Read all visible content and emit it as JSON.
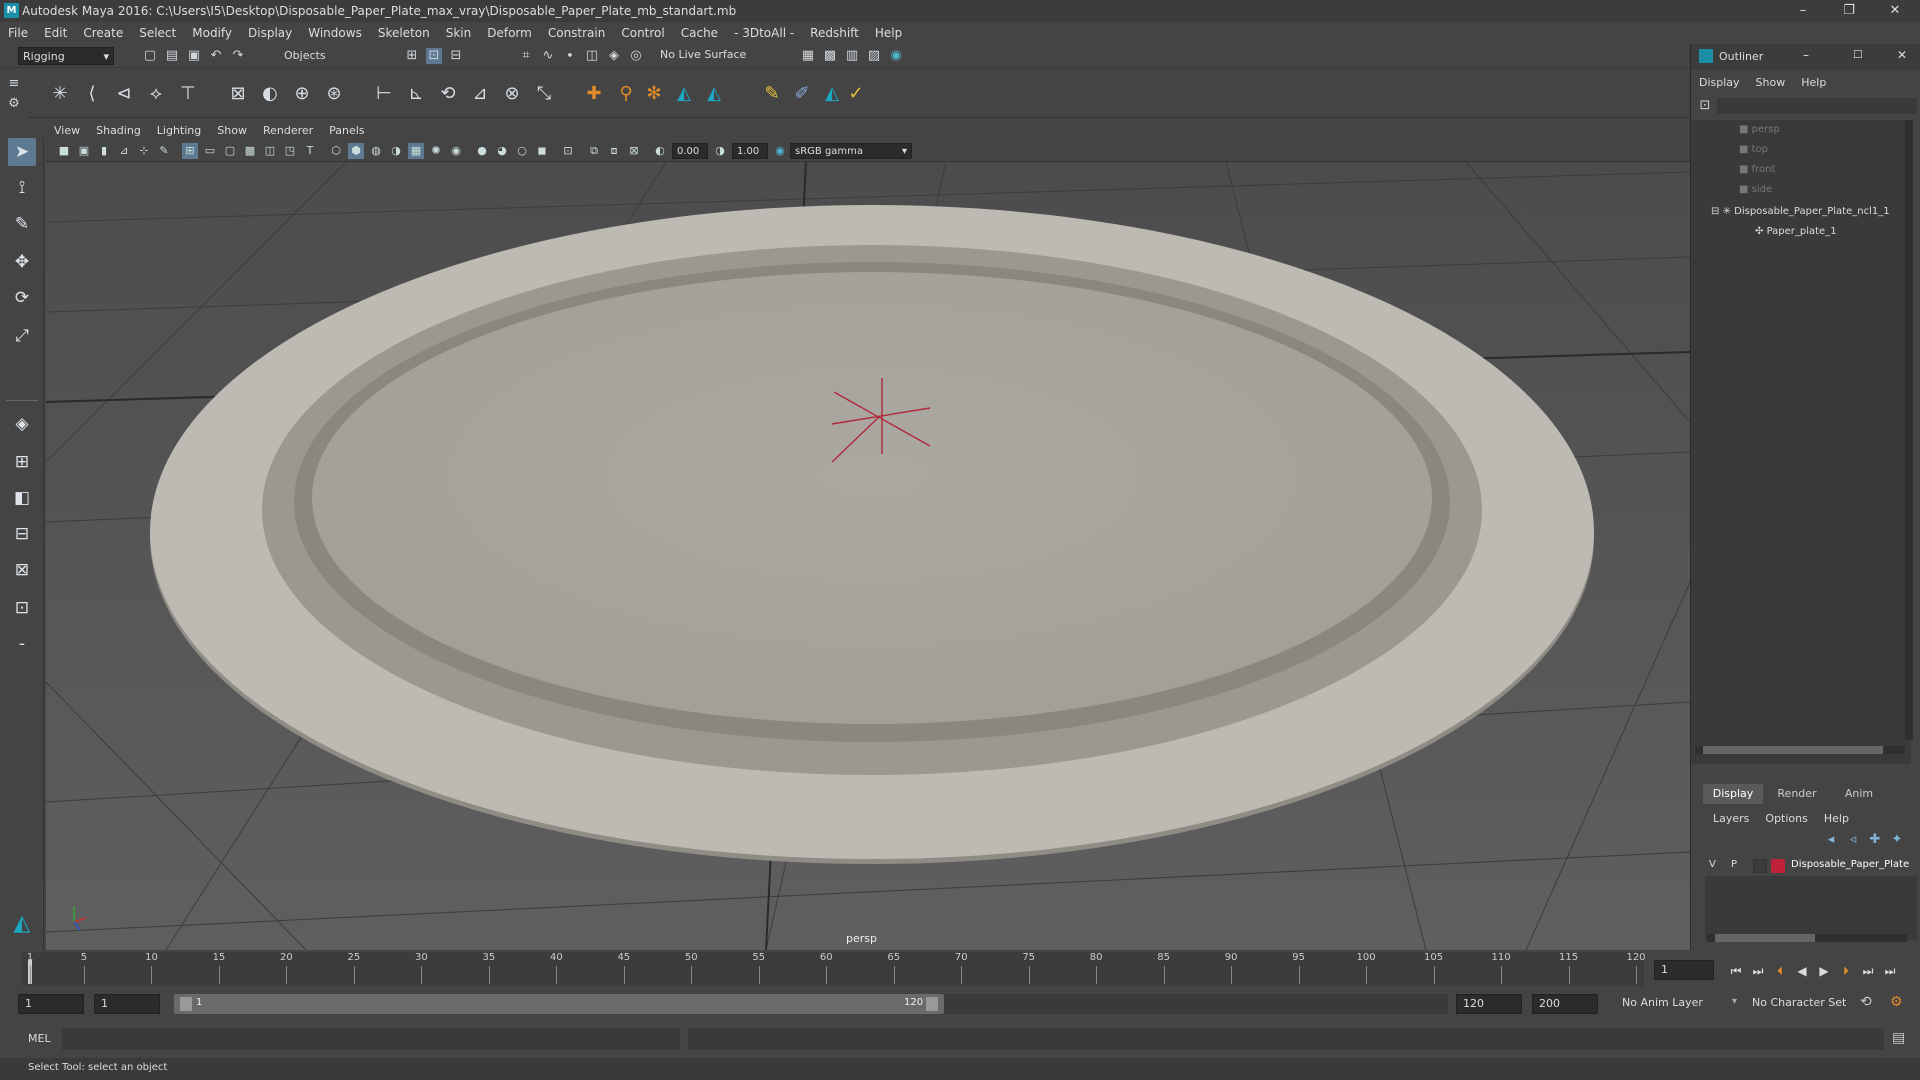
{
  "window": {
    "title": "Autodesk Maya 2016: C:\\Users\\I5\\Desktop\\Disposable_Paper_Plate_max_vray\\Disposable_Paper_Plate_mb_standart.mb",
    "logo": "M"
  },
  "menubar": [
    "File",
    "Edit",
    "Create",
    "Select",
    "Modify",
    "Display",
    "Windows",
    "Skeleton",
    "Skin",
    "Deform",
    "Constrain",
    "Control",
    "Cache",
    "- 3DtoAll -",
    "Redshift",
    "Help"
  ],
  "status": {
    "mode": "Rigging",
    "selection_mask": "Objects",
    "live_surface": "No Live Surface"
  },
  "panel_menu": [
    "View",
    "Shading",
    "Lighting",
    "Show",
    "Renderer",
    "Panels"
  ],
  "panel_toolbar": {
    "exposure": "0.00",
    "gamma": "1.00",
    "color_space": "sRGB gamma"
  },
  "viewport": {
    "camera_label": "persp",
    "background": "#6c6c6c",
    "object": "Disposable paper plate"
  },
  "outliner": {
    "title": "Outliner",
    "menu": [
      "Display",
      "Show",
      "Help"
    ],
    "items": [
      {
        "label": "persp",
        "icon": "camera-icon"
      },
      {
        "label": "top",
        "icon": "camera-icon"
      },
      {
        "label": "front",
        "icon": "camera-icon"
      },
      {
        "label": "side",
        "icon": "camera-icon"
      },
      {
        "label": "Disposable_Paper_Plate_ncl1_1",
        "icon": "group-icon"
      },
      {
        "label": "Paper_plate_1",
        "icon": "mesh-icon"
      }
    ]
  },
  "layer_editor": {
    "tabs": [
      "Display",
      "Render",
      "Anim"
    ],
    "active_tab": "Display",
    "menu": [
      "Layers",
      "Options",
      "Help"
    ],
    "layer": {
      "v": "V",
      "p": "P",
      "name": "Disposable_Paper_Plate",
      "color": "#c0213a"
    }
  },
  "timeline": {
    "ticks": [
      "1",
      "5",
      "10",
      "15",
      "20",
      "25",
      "30",
      "35",
      "40",
      "45",
      "50",
      "55",
      "60",
      "65",
      "70",
      "75",
      "80",
      "85",
      "90",
      "95",
      "100",
      "105",
      "110",
      "115",
      "120"
    ],
    "current_frame": "1"
  },
  "range": {
    "start": "1",
    "anim_start": "1",
    "range_start": "1",
    "range_end": "120",
    "end": "120",
    "anim_end": "200",
    "anim_layer": "No Anim Layer",
    "char_set": "No Character Set"
  },
  "command": {
    "label": "MEL"
  },
  "help_line": "Select Tool: select an object",
  "colors": {
    "accent": "#1b8fa5",
    "pivot": "#c0213a",
    "plate": "#b4b1aa"
  }
}
